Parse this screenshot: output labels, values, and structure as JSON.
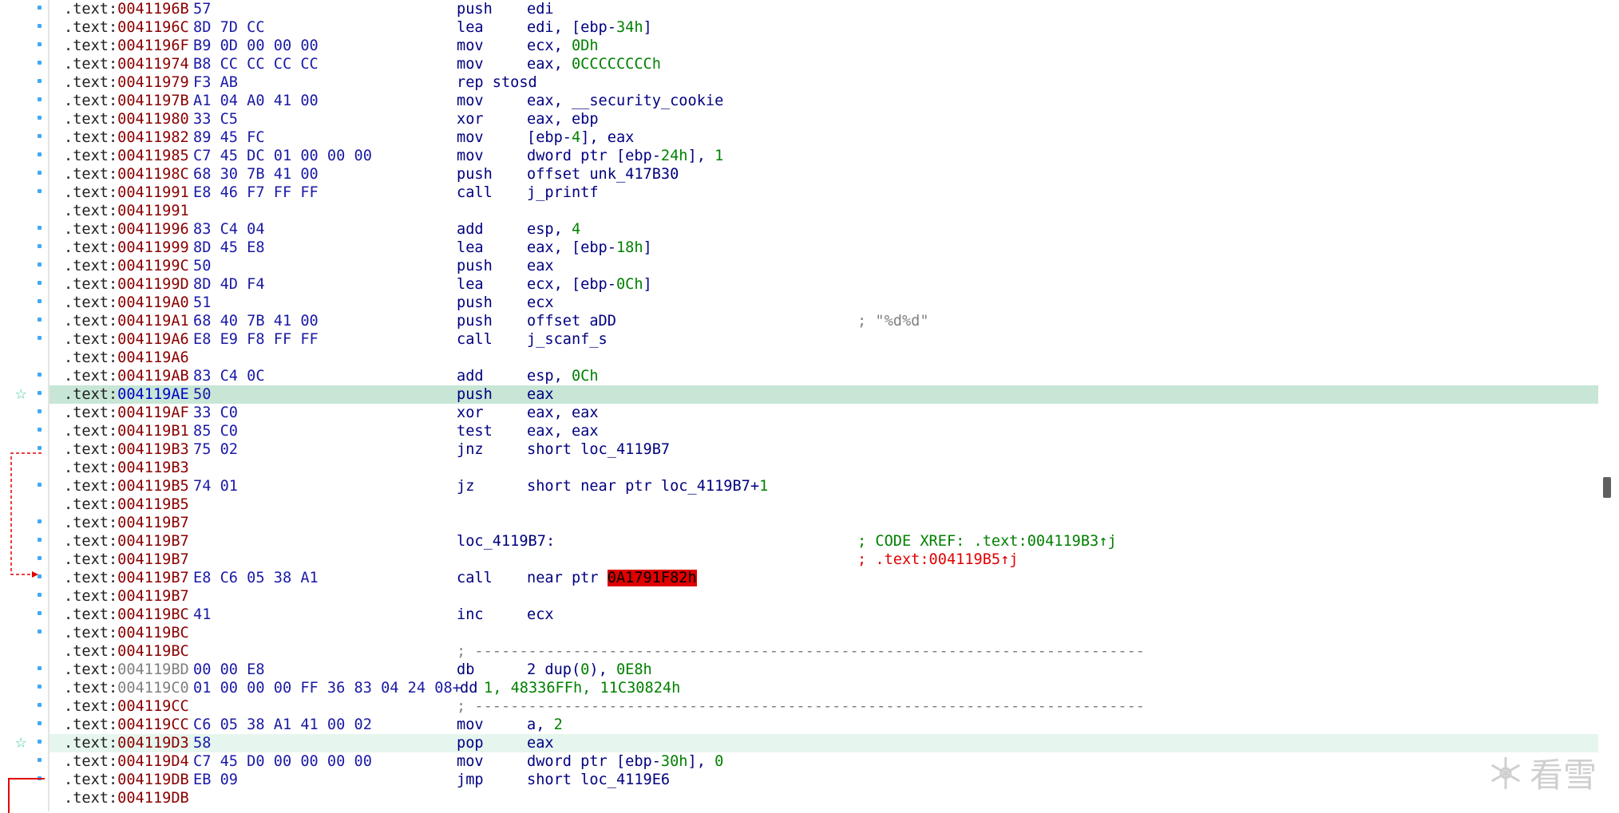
{
  "rows": [
    {
      "seg": ".text:",
      "off": "0041196B",
      "bytes": "57",
      "mnem": "push",
      "ops": [
        {
          "t": "edi"
        }
      ]
    },
    {
      "seg": ".text:",
      "off": "0041196C",
      "bytes": "8D 7D CC",
      "mnem": "lea",
      "ops": [
        {
          "t": "edi, [ebp-"
        },
        {
          "t": "34h",
          "c": "num"
        },
        {
          "t": "]"
        }
      ]
    },
    {
      "seg": ".text:",
      "off": "0041196F",
      "bytes": "B9 0D 00 00 00",
      "mnem": "mov",
      "ops": [
        {
          "t": "ecx, "
        },
        {
          "t": "0Dh",
          "c": "num"
        }
      ]
    },
    {
      "seg": ".text:",
      "off": "00411974",
      "bytes": "B8 CC CC CC CC",
      "mnem": "mov",
      "ops": [
        {
          "t": "eax, "
        },
        {
          "t": "0CCCCCCCCh",
          "c": "num"
        }
      ]
    },
    {
      "seg": ".text:",
      "off": "00411979",
      "bytes": "F3 AB",
      "mnem": "rep stosd",
      "ops": []
    },
    {
      "seg": ".text:",
      "off": "0041197B",
      "bytes": "A1 04 A0 41 00",
      "mnem": "mov",
      "ops": [
        {
          "t": "eax, __security_cookie"
        }
      ]
    },
    {
      "seg": ".text:",
      "off": "00411980",
      "bytes": "33 C5",
      "mnem": "xor",
      "ops": [
        {
          "t": "eax, ebp"
        }
      ]
    },
    {
      "seg": ".text:",
      "off": "00411982",
      "bytes": "89 45 FC",
      "mnem": "mov",
      "ops": [
        {
          "t": "[ebp-"
        },
        {
          "t": "4",
          "c": "num"
        },
        {
          "t": "], eax"
        }
      ]
    },
    {
      "seg": ".text:",
      "off": "00411985",
      "bytes": "C7 45 DC 01 00 00 00",
      "mnem": "mov",
      "ops": [
        {
          "t": "dword ptr [ebp-"
        },
        {
          "t": "24h",
          "c": "num"
        },
        {
          "t": "], "
        },
        {
          "t": "1",
          "c": "num"
        }
      ]
    },
    {
      "seg": ".text:",
      "off": "0041198C",
      "bytes": "68 30 7B 41 00",
      "mnem": "push",
      "ops": [
        {
          "t": "offset unk_417B30"
        }
      ]
    },
    {
      "seg": ".text:",
      "off": "00411991",
      "bytes": "E8 46 F7 FF FF",
      "mnem": "call",
      "ops": [
        {
          "t": "j_printf"
        }
      ]
    },
    {
      "seg": ".text:",
      "off": "00411991",
      "bytes": "",
      "mnem": "",
      "ops": []
    },
    {
      "seg": ".text:",
      "off": "00411996",
      "bytes": "83 C4 04",
      "mnem": "add",
      "ops": [
        {
          "t": "esp, "
        },
        {
          "t": "4",
          "c": "num"
        }
      ]
    },
    {
      "seg": ".text:",
      "off": "00411999",
      "bytes": "8D 45 E8",
      "mnem": "lea",
      "ops": [
        {
          "t": "eax, [ebp-"
        },
        {
          "t": "18h",
          "c": "num"
        },
        {
          "t": "]"
        }
      ]
    },
    {
      "seg": ".text:",
      "off": "0041199C",
      "bytes": "50",
      "mnem": "push",
      "ops": [
        {
          "t": "eax"
        }
      ]
    },
    {
      "seg": ".text:",
      "off": "0041199D",
      "bytes": "8D 4D F4",
      "mnem": "lea",
      "ops": [
        {
          "t": "ecx, [ebp-"
        },
        {
          "t": "0Ch",
          "c": "num"
        },
        {
          "t": "]"
        }
      ]
    },
    {
      "seg": ".text:",
      "off": "004119A0",
      "bytes": "51",
      "mnem": "push",
      "ops": [
        {
          "t": "ecx"
        }
      ]
    },
    {
      "seg": ".text:",
      "off": "004119A1",
      "bytes": "68 40 7B 41 00",
      "mnem": "push",
      "ops": [
        {
          "t": "offset aDD"
        }
      ],
      "cmt": "; \"%d%d\""
    },
    {
      "seg": ".text:",
      "off": "004119A6",
      "bytes": "E8 E9 F8 FF FF",
      "mnem": "call",
      "ops": [
        {
          "t": "j_scanf_s"
        }
      ]
    },
    {
      "seg": ".text:",
      "off": "004119A6",
      "bytes": "",
      "mnem": "",
      "ops": []
    },
    {
      "seg": ".text:",
      "off": "004119AB",
      "bytes": "83 C4 0C",
      "mnem": "add",
      "ops": [
        {
          "t": "esp, "
        },
        {
          "t": "0Ch",
          "c": "num"
        }
      ]
    },
    {
      "seg": ".text:",
      "off": "004119AE",
      "bytes": "50",
      "mnem": "push",
      "ops": [
        {
          "t": "eax"
        }
      ],
      "hl": "sel"
    },
    {
      "seg": ".text:",
      "off": "004119AF",
      "bytes": "33 C0",
      "mnem": "xor",
      "ops": [
        {
          "t": "eax, eax"
        }
      ]
    },
    {
      "seg": ".text:",
      "off": "004119B1",
      "bytes": "85 C0",
      "mnem": "test",
      "ops": [
        {
          "t": "eax, eax"
        }
      ]
    },
    {
      "seg": ".text:",
      "off": "004119B3",
      "bytes": "75 02",
      "mnem": "jnz",
      "ops": [
        {
          "t": "short loc_4119B7"
        }
      ]
    },
    {
      "seg": ".text:",
      "off": "004119B3",
      "bytes": "",
      "mnem": "",
      "ops": []
    },
    {
      "seg": ".text:",
      "off": "004119B5",
      "bytes": "74 01",
      "mnem": "jz",
      "ops": [
        {
          "t": "short near ptr loc_4119B7+"
        },
        {
          "t": "1",
          "c": "num"
        }
      ]
    },
    {
      "seg": ".text:",
      "off": "004119B5",
      "bytes": "",
      "mnem": "",
      "ops": []
    },
    {
      "seg": ".text:",
      "off": "004119B7",
      "bytes": "",
      "mnem": "",
      "ops": []
    },
    {
      "seg": ".text:",
      "off": "004119B7",
      "bytes": "",
      "mnem": "loc_4119B7:",
      "ops": [],
      "cmt": "; CODE XREF: .text:004119B3↑j",
      "cmtc": "xref"
    },
    {
      "seg": ".text:",
      "off": "004119B7",
      "bytes": "",
      "mnem": "",
      "ops": [],
      "cmt": "; .text:004119B5↑j",
      "cmtc": "xrefr"
    },
    {
      "seg": ".text:",
      "off": "004119B7",
      "bytes": "E8 C6 05 38 A1",
      "mnem": "call",
      "ops": [
        {
          "t": "near ptr "
        },
        {
          "t": "0A1791F82h",
          "c": "bad"
        }
      ]
    },
    {
      "seg": ".text:",
      "off": "004119B7",
      "bytes": "",
      "mnem": "",
      "ops": []
    },
    {
      "seg": ".text:",
      "off": "004119BC",
      "bytes": "41",
      "mnem": "inc",
      "ops": [
        {
          "t": "ecx"
        }
      ]
    },
    {
      "seg": ".text:",
      "off": "004119BC",
      "bytes": "",
      "mnem": "",
      "ops": []
    },
    {
      "seg": ".text:",
      "off": "004119BC",
      "bytes": "",
      "mnem": "",
      "ops": [],
      "sep": "; ---------------------------------------------------------------------------"
    },
    {
      "seg": ".text:",
      "off": "004119BD",
      "bytes": "00 00 E8",
      "mnem": "db",
      "ops": [
        {
          "t": "2 dup("
        },
        {
          "t": "0",
          "c": "num"
        },
        {
          "t": "), "
        },
        {
          "t": "0E8h",
          "c": "num"
        }
      ],
      "data": true
    },
    {
      "seg": ".text:",
      "off": "004119C0",
      "bytes": "01 00 00 00 FF 36 83 04 24 08+",
      "mnem": "dd",
      "ops": [
        {
          "t": "1, 48336FFh, 11C30824h",
          "c": "num"
        }
      ],
      "data": true,
      "ddmnem": true
    },
    {
      "seg": ".text:",
      "off": "004119CC",
      "bytes": "",
      "mnem": "",
      "ops": [],
      "sep": "; ---------------------------------------------------------------------------"
    },
    {
      "seg": ".text:",
      "off": "004119CC",
      "bytes": "C6 05 38 A1 41 00 02",
      "mnem": "mov",
      "ops": [
        {
          "t": "a, "
        },
        {
          "t": "2",
          "c": "num"
        }
      ]
    },
    {
      "seg": ".text:",
      "off": "004119D3",
      "bytes": "58",
      "mnem": "pop",
      "ops": [
        {
          "t": "eax"
        }
      ],
      "hl": "cur"
    },
    {
      "seg": ".text:",
      "off": "004119D4",
      "bytes": "C7 45 D0 00 00 00 00",
      "mnem": "mov",
      "ops": [
        {
          "t": "dword ptr [ebp-"
        },
        {
          "t": "30h",
          "c": "num"
        },
        {
          "t": "], "
        },
        {
          "t": "0",
          "c": "num"
        }
      ]
    },
    {
      "seg": ".text:",
      "off": "004119DB",
      "bytes": "EB 09",
      "mnem": "jmp",
      "ops": [
        {
          "t": "short loc_4119E6"
        }
      ]
    },
    {
      "seg": ".text:",
      "off": "004119DB",
      "bytes": "",
      "mnem": "",
      "ops": []
    }
  ],
  "watermark": {
    "logo": "snowflake-logo",
    "text": "看雪"
  },
  "colors": {
    "selected": "#c8e6d6",
    "current": "#e6f6ee",
    "error": "#e00000",
    "number": "#008000"
  }
}
